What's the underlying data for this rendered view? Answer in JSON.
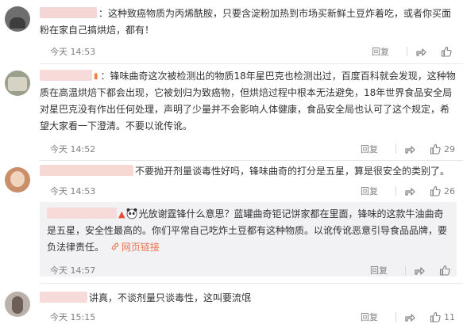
{
  "comments": [
    {
      "text": "：这种致癌物质为丙烯酰胺，只要含淀粉加热到市场买新鲜土豆炸着吃，或者你买面粉在家自己搞烘焙，都有！",
      "time": "今天 14:53",
      "reply": "回复",
      "likes": "",
      "avatar_color": "#6e6e6e",
      "name_color": "#f5d6d6"
    },
    {
      "text": "：锋味曲奇这次被检测出的物质18年星巴克也检测出过，百度百科就会发现，这种物质在高温烘焙下都会出现，它被划归为致癌物，但烘焙过程中根本无法避免，18年世界食品安全局对星巴克没有作出任何处理，声明了少量并不会影响人体健康，食品安全局也认可了这个规定，希望大家看一下澄清。不要以讹传讹。",
      "time": "今天 14:52",
      "reply": "回复",
      "likes": "29",
      "avatar_color": "#9aa08a",
      "name_color": "#f7dada"
    },
    {
      "text": "不要抛开剂量谈毒性好吗，锋味曲奇的打分是五星，算是很安全的类别了。",
      "time": "今天 14:53",
      "reply": "回复",
      "likes": "26",
      "avatar_color": "#c98e6a",
      "name_color": "#f6d9d2"
    },
    {
      "text": "讲真，不谈剂量只谈毒性，这叫要流氓",
      "time": "今天 15:15",
      "reply": "回复",
      "likes": "11",
      "avatar_color": "#b9b1aa",
      "name_color": "#f7dada"
    }
  ],
  "sub_reply": {
    "text": "光放谢霆锋什么意思？蓝罐曲奇钜记饼家都在里面，锋味的这款牛油曲奇是五星，安全性最高的。你们平常自己吃炸土豆都有这种物质。以讹传讹恶意引导食品品牌，要负法律责任。",
    "link_text": "网页链接",
    "time": "今天 14:57",
    "reply": "回复",
    "likes": "",
    "name_color": "#f7dada"
  },
  "colors": {
    "link": "#eb7350",
    "sub_bg": "#f2f2f5",
    "meta": "#808080"
  }
}
